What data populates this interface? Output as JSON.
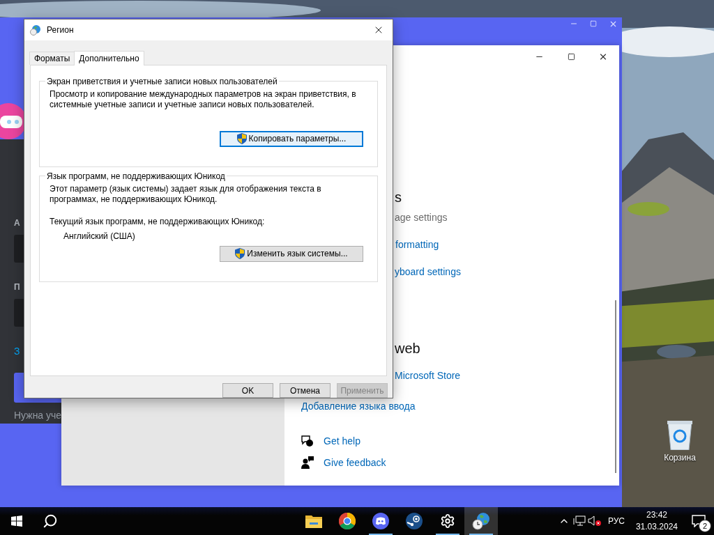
{
  "background_app": {
    "labels": [
      {
        "kind": "label",
        "text": "А"
      },
      {
        "kind": "label",
        "text": "П"
      },
      {
        "kind": "link",
        "text": "З"
      },
      {
        "kind": "muted",
        "text": "Нужна уче"
      }
    ]
  },
  "settings_window": {
    "items": [
      {
        "kind": "heading",
        "text": "s"
      },
      {
        "kind": "muted",
        "text": "age settings"
      },
      {
        "kind": "link",
        "text": "formatting"
      },
      {
        "kind": "link",
        "text": "yboard settings"
      },
      {
        "kind": "heading",
        "text": "web"
      },
      {
        "kind": "link",
        "text": "Microsoft Store"
      },
      {
        "kind": "link",
        "text": "Добавление языка ввода"
      }
    ],
    "help": [
      {
        "kind": "help",
        "text": "Get help"
      },
      {
        "kind": "feedback",
        "text": "Give feedback"
      }
    ]
  },
  "dialog": {
    "title": "Регион",
    "tabs": [
      {
        "label": "Форматы",
        "selected": false
      },
      {
        "label": "Дополнительно",
        "selected": true
      }
    ],
    "groups": [
      {
        "title": "Экран приветствия и учетные записи новых пользователей",
        "description": "Просмотр и копирование международных параметров на экран приветствия, в системные учетные записи и учетные записи новых пользователей.",
        "button": "Копировать параметры...",
        "focused": true
      },
      {
        "title": "Язык программ, не поддерживающих Юникод",
        "description": "Этот параметр (язык системы) задает язык для отображения текста в программах, не поддерживающих Юникод.",
        "current_label": "Текущий язык программ, не поддерживающих Юникод:",
        "current_value": "Английский (США)",
        "button": "Изменить язык системы...",
        "focused": false
      }
    ],
    "buttons": [
      {
        "label": "OK",
        "disabled": false
      },
      {
        "label": "Отмена",
        "disabled": false
      },
      {
        "label": "Применить",
        "disabled": true
      }
    ]
  },
  "desktop_icons": [
    {
      "label": "Корзина"
    }
  ],
  "taskbar": {
    "apps": [
      {
        "kind": "explorer",
        "running": false,
        "active": false
      },
      {
        "kind": "chrome",
        "running": false,
        "active": false
      },
      {
        "kind": "discord",
        "running": true,
        "active": false
      },
      {
        "kind": "steam",
        "running": false,
        "active": false
      },
      {
        "kind": "settings",
        "running": true,
        "active": false
      },
      {
        "kind": "region",
        "running": true,
        "active": true
      }
    ],
    "language": "РУС",
    "time": "23:42",
    "date": "31.03.2024",
    "notifications": "2"
  }
}
